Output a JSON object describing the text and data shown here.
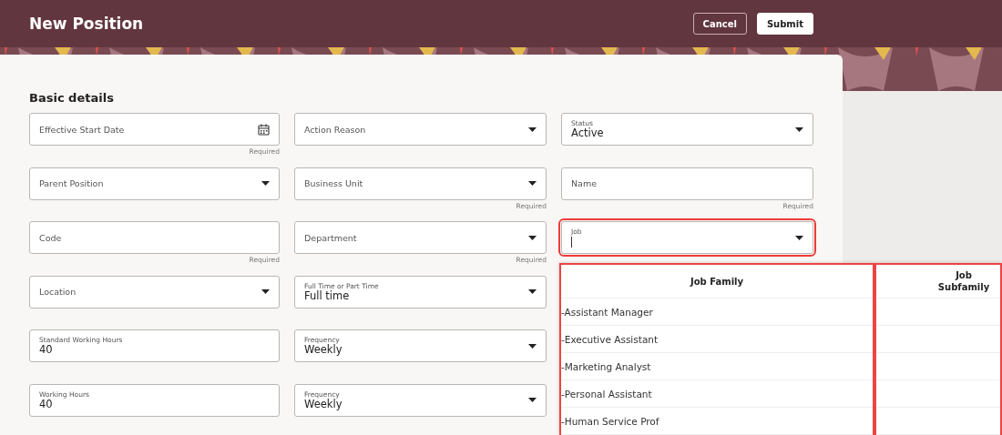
{
  "header": {
    "title": "New Position",
    "buttons": [
      {
        "label": "Cancel",
        "kind": "secondary"
      },
      {
        "label": "Submit",
        "kind": "primary"
      }
    ]
  },
  "section": {
    "title": "Basic details"
  },
  "fields": [
    {
      "label": "Effective Start Date",
      "kind": "date",
      "required": "Required"
    },
    {
      "label": "Action Reason",
      "kind": "select"
    },
    {
      "label": "Status",
      "kind": "select",
      "value": "Active"
    },
    {
      "label": "Parent Position",
      "kind": "select"
    },
    {
      "label": "Business Unit",
      "kind": "select",
      "required": "Required"
    },
    {
      "label": "Name",
      "kind": "text",
      "required": "Required"
    },
    {
      "label": "Code",
      "kind": "text",
      "required": "Required"
    },
    {
      "label": "Department",
      "kind": "select",
      "required": "Required"
    },
    {
      "label": "Job",
      "kind": "select",
      "focused": true,
      "highlighted": true
    },
    {
      "label": "Location",
      "kind": "select"
    },
    {
      "label": "Full Time or Part Time",
      "kind": "select",
      "value": "Full time"
    },
    {
      "kind": "none"
    },
    {
      "label": "Standard Working Hours",
      "kind": "text",
      "value": "40"
    },
    {
      "label": "Frequency",
      "kind": "select",
      "value": "Weekly"
    },
    {
      "kind": "none"
    },
    {
      "label": "Working Hours",
      "kind": "text",
      "value": "40"
    },
    {
      "label": "Frequency",
      "kind": "select",
      "value": "Weekly"
    }
  ],
  "job_dropdown": {
    "columns": [
      {
        "label": "Job Family",
        "highlighted": true
      },
      {
        "label": "Job Subfamily",
        "highlighted": true
      }
    ],
    "rows": [
      {
        "job_family": "-Assistant Manager"
      },
      {
        "job_family": "-Executive Assistant"
      },
      {
        "job_family": "-Marketing Analyst"
      },
      {
        "job_family": "-Personal Assistant"
      },
      {
        "job_family": "-Human Service Prof"
      }
    ]
  }
}
